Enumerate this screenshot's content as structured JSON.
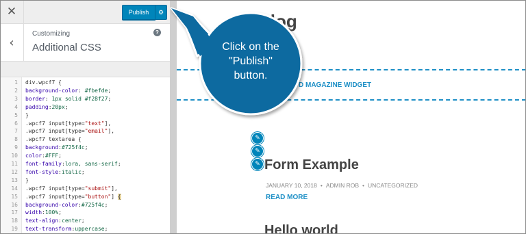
{
  "topbar": {
    "close_icon": "close-icon",
    "publish_label": "Publish",
    "publish_options_icon": "gear-icon"
  },
  "header": {
    "back_icon": "chevron-left-icon",
    "customizing_label": "Customizing",
    "section_title": "Additional CSS",
    "help_icon": "?"
  },
  "code_editor": {
    "lines": [
      {
        "num": "1",
        "text": "div.wpcf7 {"
      },
      {
        "num": "2",
        "text": "background-color: #fbefde;"
      },
      {
        "num": "3",
        "text": "border: 1px solid #f28f27;"
      },
      {
        "num": "4",
        "text": "padding:20px;"
      },
      {
        "num": "5",
        "text": "}"
      },
      {
        "num": "6",
        "text": ".wpcf7 input[type=\"text\"],"
      },
      {
        "num": "7",
        "text": ".wpcf7 input[type=\"email\"],"
      },
      {
        "num": "8",
        "text": ".wpcf7 textarea {"
      },
      {
        "num": "9",
        "text": "background:#725f4c;"
      },
      {
        "num": "10",
        "text": "color:#FFF;"
      },
      {
        "num": "11",
        "text": "font-family:lora, sans-serif;"
      },
      {
        "num": "12",
        "text": "font-style:italic;"
      },
      {
        "num": "13",
        "text": "}"
      },
      {
        "num": "14",
        "text": ".wpcf7 input[type=\"submit\"],"
      },
      {
        "num": "15",
        "text": ".wpcf7 input[type=\"button\"] {"
      },
      {
        "num": "16",
        "text": "background-color:#725f4c;"
      },
      {
        "num": "17",
        "text": "width:100%;"
      },
      {
        "num": "18",
        "text": "text-align:center;"
      },
      {
        "num": "19",
        "text": "text-transform:uppercase;"
      }
    ]
  },
  "preview": {
    "blog_title": "Blog",
    "widget_label": "D MAGAZINE WIDGET",
    "edit_icon": "pencil-icon",
    "post_title": "Form Example",
    "post_date": "JANUARY 10, 2018",
    "post_author": "ADMIN ROB",
    "post_category": "UNCATEGORIZED",
    "meta_separator": "•",
    "read_more": "READ MORE",
    "next_title_partial": "Hello world"
  },
  "callout": {
    "text_line1": "Click on the",
    "text_line2": "\"Publish\"",
    "text_line3": "button.",
    "color": "#0f6aa0"
  },
  "colors": {
    "accent": "#0085ba",
    "link": "#1d8fc6"
  }
}
